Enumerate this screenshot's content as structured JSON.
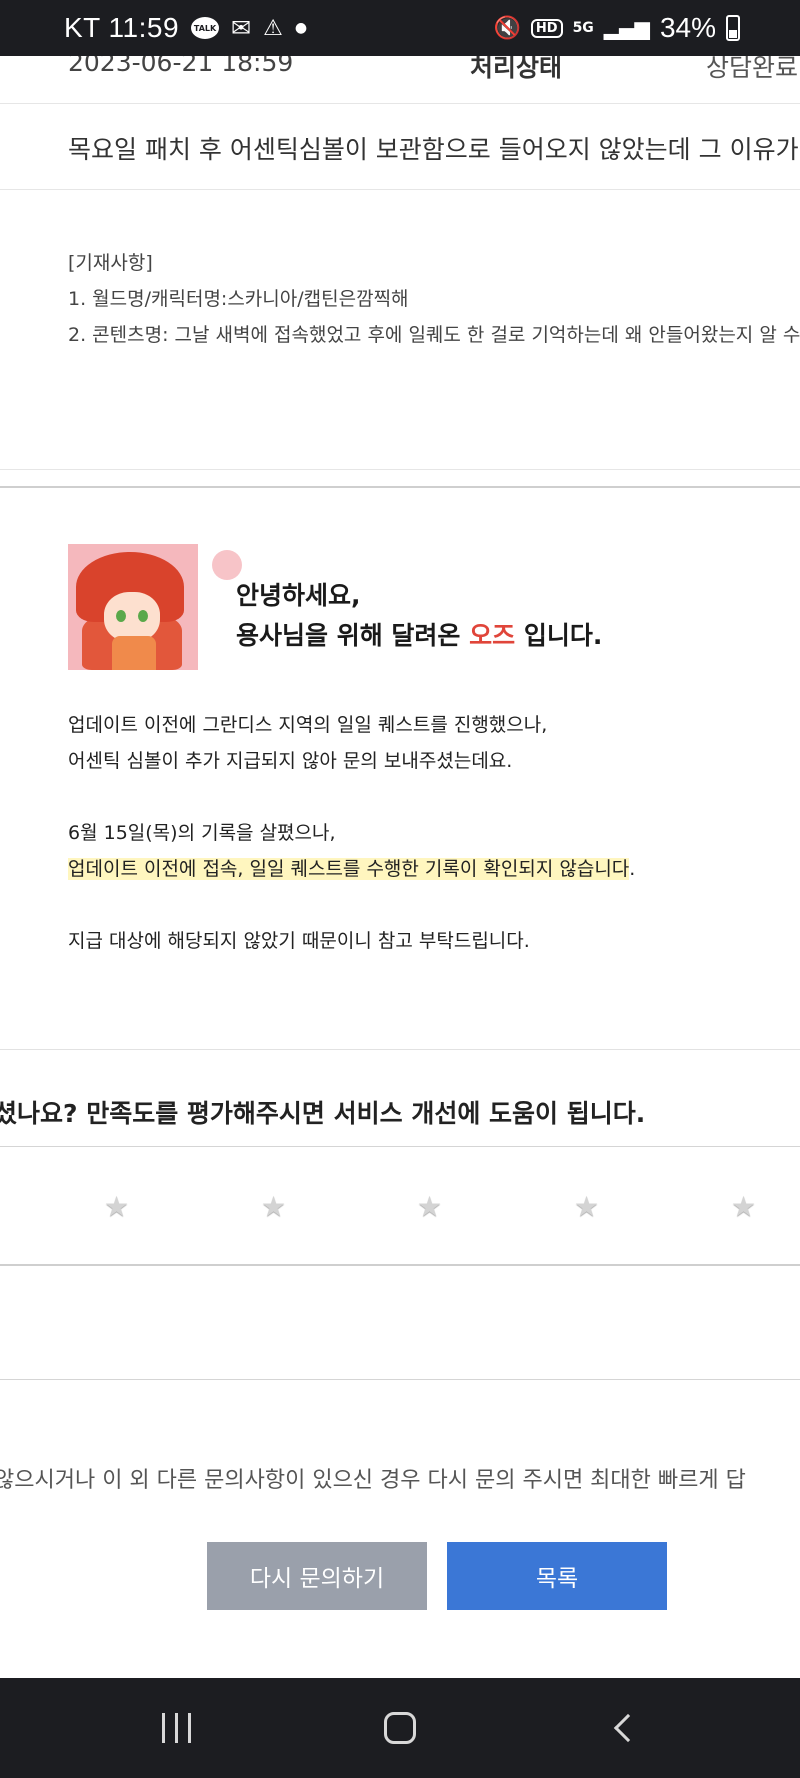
{
  "status_bar": {
    "time": "KT 11:59",
    "battery": "34%",
    "network": "5G",
    "hd": "HD",
    "talk": "TALK"
  },
  "inquiry": {
    "date": "2023-06-21 18:59",
    "status_label": "처리상태",
    "status_value": "상담완료",
    "subject": "목요일 패치 후 어센틱심볼이 보관함으로 들어오지 않았는데 그 이유가 궁금",
    "body": {
      "header": "[기재사항]",
      "line1": "1. 월드명/캐릭터명:스카니아/캡틴은깜찍해",
      "line2": "2. 콘텐츠명: 그날 새벽에 접속했었고 후에 일퀘도 한 걸로 기억하는데 왜 안들어왔는지 알 수"
    }
  },
  "answer": {
    "greeting_line1": "안녕하세요,",
    "greeting_line2_pre": "용사님을 위해 달려온 ",
    "greeting_name": "오즈",
    "greeting_line2_post": " 입니다.",
    "p1_line1": "업데이트 이전에 그란디스 지역의 일일 퀘스트를 진행했으나,",
    "p1_line2": "어센틱 심볼이 추가 지급되지 않아 문의 보내주셨는데요.",
    "p2_line1": "6월 15일(목)의 기록을 살폈으나,",
    "p2_highlight": "업데이트 이전에 접속, 일일 퀘스트를 수행한 기록이 확인되지 않습니다",
    "p2_period": ".",
    "p3_line1": "지급 대상에 해당되지 않았기 때문이니 참고 부탁드립니다."
  },
  "rating": {
    "prompt": "셨나요? 만족도를 평가해주시면 서비스 개선에 도움이 됩니다.",
    "star_glyph": "★",
    "star_count": 5,
    "selected": 0
  },
  "notice": "않으시거나 이 외 다른 문의사항이 있으신 경우 다시 문의 주시면 최대한 빠르게 답",
  "buttons": {
    "retry": "다시 문의하기",
    "list": "목록"
  },
  "colors": {
    "accent_blue": "#3b77d6",
    "button_gray": "#9aa0ab",
    "highlight": "#fff6bf",
    "name_red": "#e0453a"
  }
}
